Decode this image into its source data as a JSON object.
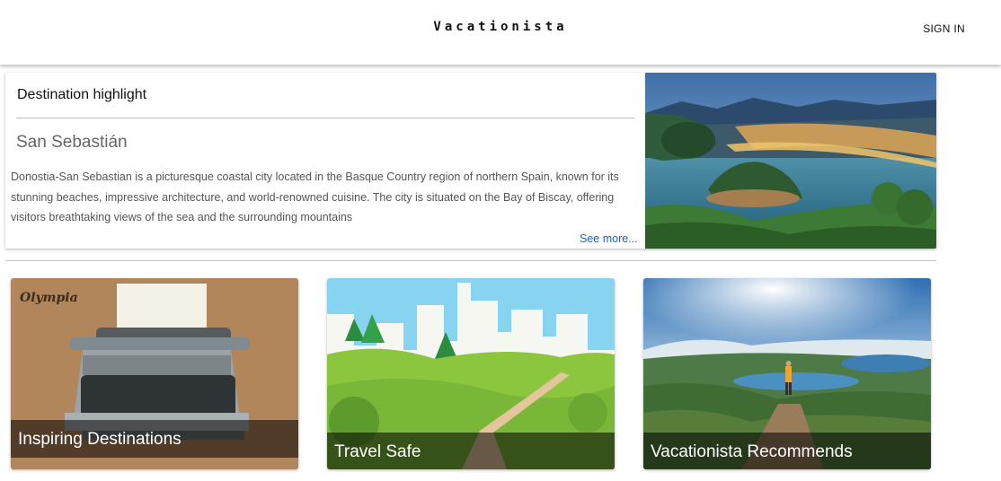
{
  "header": {
    "brand": "Vacationista",
    "signin_label": "SIGN IN"
  },
  "highlight": {
    "label": "Destination highlight",
    "city": "San Sebastián",
    "description": "Donostia-San Sebastian is a picturesque coastal city located in the Basque Country region of northern Spain, known for its stunning beaches, impressive architecture, and world-renowned cuisine. The city is situated on the Bay of Biscay, offering visitors breathtaking views of the sea and the surrounding mountains",
    "see_more_label": "See more..."
  },
  "cards": [
    {
      "title": "Inspiring Destinations"
    },
    {
      "title": "Travel Safe"
    },
    {
      "title": "Vacationista Recommends"
    }
  ]
}
